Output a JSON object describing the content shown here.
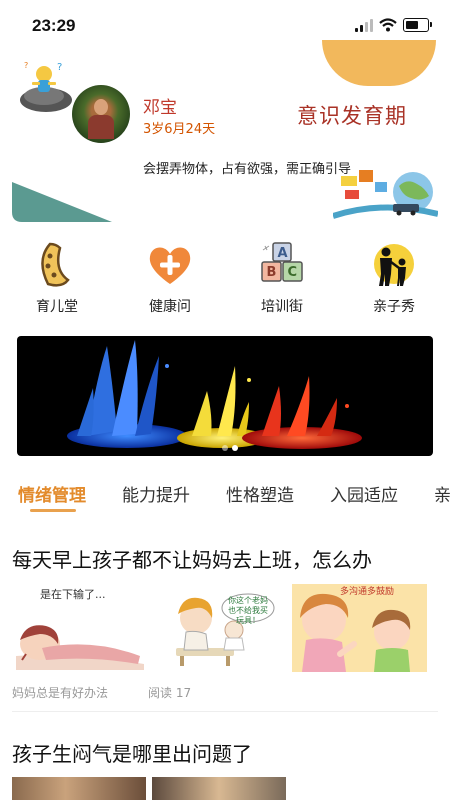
{
  "status": {
    "time": "23:29"
  },
  "profile": {
    "name": "邓宝",
    "age": "3岁6月24天",
    "stage": "意识发育期",
    "description": "会摆弄物体，占有欲强，需正确引导"
  },
  "nav": [
    {
      "label": "育儿堂",
      "icon": "crescent-book-icon"
    },
    {
      "label": "健康问",
      "icon": "heart-plus-icon"
    },
    {
      "label": "培训街",
      "icon": "abc-blocks-icon"
    },
    {
      "label": "亲子秀",
      "icon": "parent-child-icon"
    }
  ],
  "tabs": [
    "情绪管理",
    "能力提升",
    "性格塑造",
    "入园适应",
    "亲"
  ],
  "articles": [
    {
      "title": "每天早上孩子都不让妈妈去上班，怎么办",
      "author": "妈妈总是有好办法",
      "reads": "阅读 17",
      "image_caption_1": "是在下输了...",
      "image_caption_2": "你这个老妈也不给我买玩具！",
      "image_caption_3": "多沟通多鼓励"
    },
    {
      "title": "孩子生闷气是哪里出问题了"
    }
  ],
  "colors": {
    "accent": "#e38b2c",
    "title_red": "#a93226",
    "name_red": "#c0392b",
    "age_orange": "#d35400"
  }
}
